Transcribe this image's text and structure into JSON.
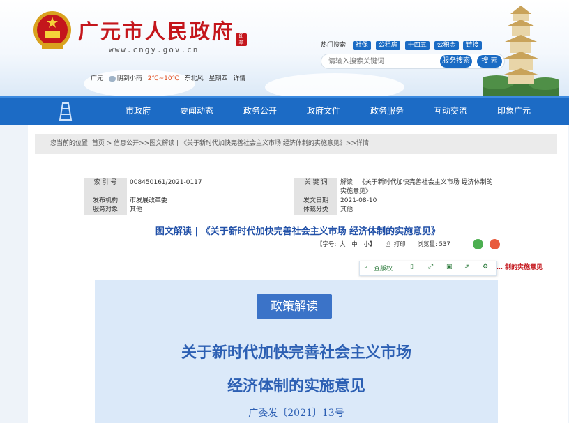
{
  "header": {
    "site_title": "广元市人民政府",
    "site_url": "www.cngy.gov.cn",
    "weather": {
      "city": "广元",
      "condition": "阴到小雨",
      "temp": "2℃~10℃",
      "wind": "东北风",
      "weekday": "星期四",
      "details_link": "详情"
    },
    "hot_search": {
      "label": "热门搜索:",
      "tags": [
        "社保",
        "公租房",
        "十四五",
        "公积金",
        "链接"
      ]
    },
    "search": {
      "placeholder": "请输入搜索关键词",
      "service_button": "服务搜索",
      "search_button": "搜 索"
    }
  },
  "nav": {
    "items": [
      "市政府",
      "要闻动态",
      "政务公开",
      "政府文件",
      "政务服务",
      "互动交流",
      "印象广元"
    ]
  },
  "breadcrumb": "您当前的位置: 首页 > 信息公开>>图文解读 | 《关于新时代加快完善社会主义市场 经济体制的实施意见》>>详情",
  "meta": {
    "index_no_label": "索 引 号",
    "index_no": "008450161/2021-0117",
    "keyword_label": "关 键 词",
    "keyword": "解读 | 《关于新时代加快完善社会主义市场 经济体制的实施意见》",
    "publisher_label": "发布机构",
    "publisher": "市发展改革委",
    "date_label": "发文日期",
    "date": "2021-08-10",
    "target_label": "服务对象",
    "target": "其他",
    "category_label": "体裁分类",
    "category": "其他"
  },
  "doc_title": "图文解读 | 《关于新时代加快完善社会主义市场 经济体制的实施意见》",
  "toolbar": {
    "font_label": "【字号:",
    "size_large": "大",
    "size_mid": "中",
    "size_small": "小】",
    "print": "打印",
    "views": "浏览量: 537"
  },
  "file_line": "文件: 中共广元市委  广元市人民政府  关 … 制的实施意见",
  "float_tools": {
    "view_label": "查版权"
  },
  "poster": {
    "badge": "政策解读",
    "title_line1": "关于新时代加快完善社会主义市场",
    "title_line2": "经济体制的实施意见",
    "doc_no": "广委发〔2021〕13号"
  },
  "colors": {
    "brand_red": "#c4161c",
    "nav_blue": "#1c6bc5",
    "title_blue": "#2251a8"
  }
}
